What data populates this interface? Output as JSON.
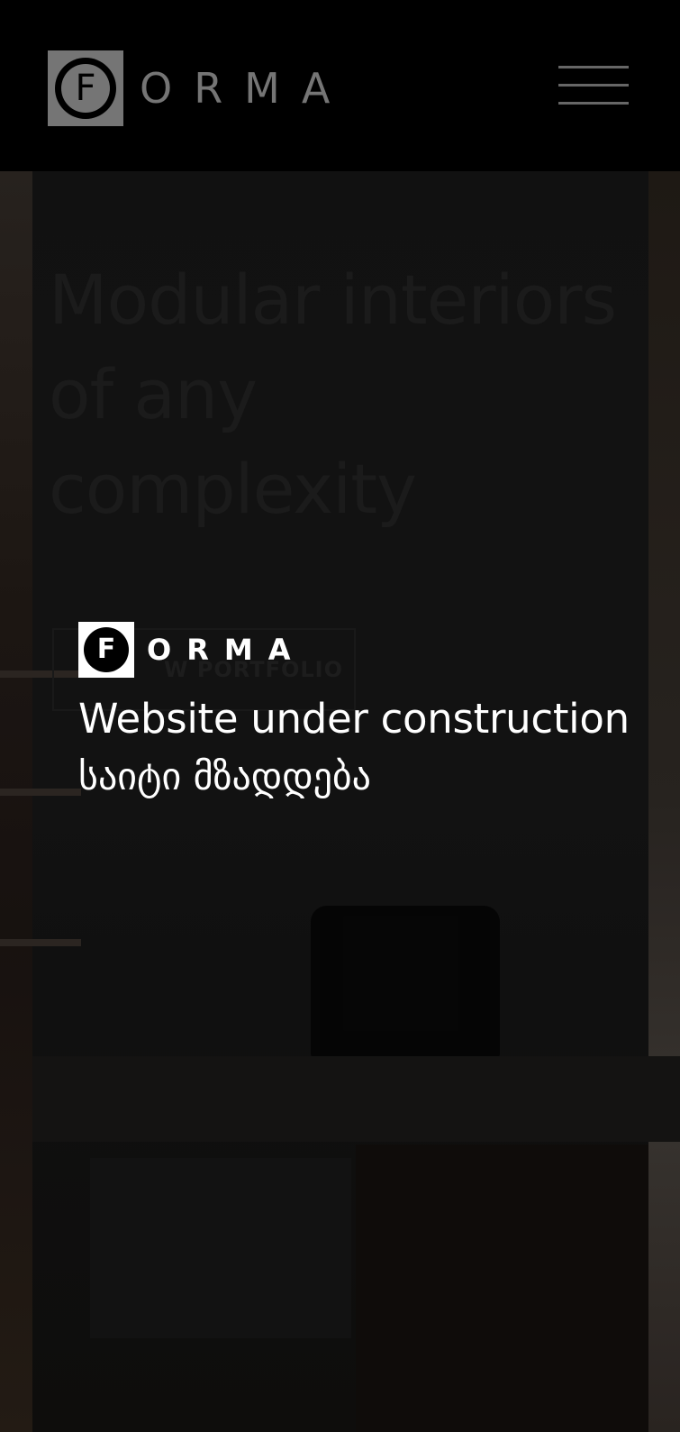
{
  "colors": {
    "header_background": "#000000",
    "logo_gray": "#7c7c7c",
    "notice_text": "#ffffff",
    "page_background": "#0d0d0d"
  },
  "header": {
    "logo_letter": "F",
    "logo_word": "ORMA",
    "menu_icon": "hamburger-menu-icon"
  },
  "hero": {
    "heading": "Modular interiors of any complexity",
    "button_label": "W PORTFOLIO"
  },
  "notice": {
    "logo_letter": "F",
    "logo_word": "ORMA",
    "message_en": "Website under construction",
    "message_ka": "საიტი მზადდება"
  }
}
